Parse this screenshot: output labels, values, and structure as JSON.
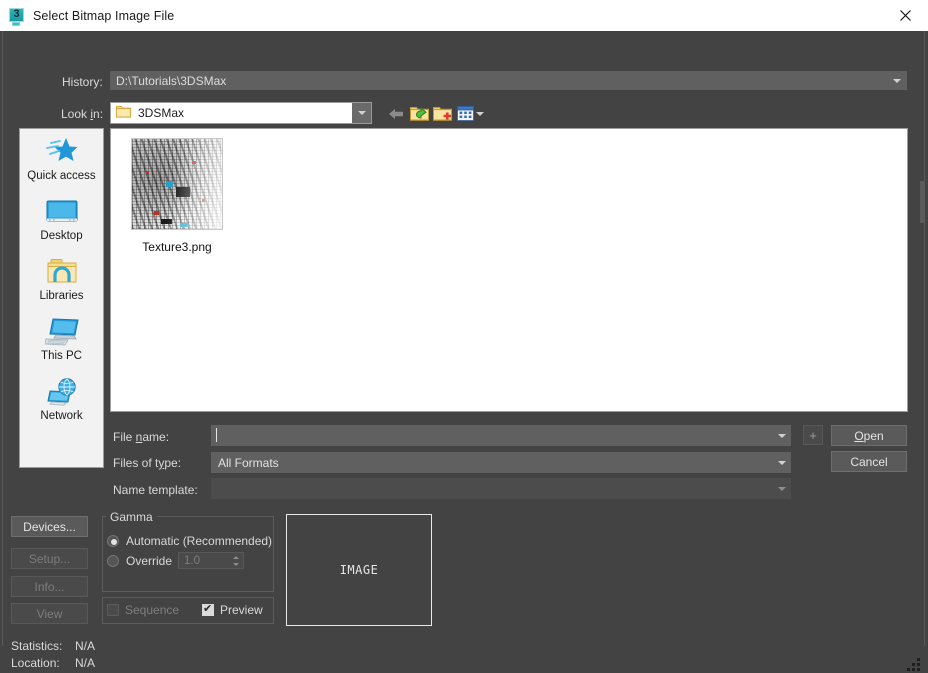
{
  "window": {
    "title": "Select Bitmap Image File",
    "app_icon": "3dsmax-icon",
    "close_label": "✕"
  },
  "history": {
    "label": "History:",
    "value": "D:\\Tutorials\\3DSMax",
    "dropdown_icon": "chevron-down-icon"
  },
  "lookin": {
    "label_pre": "Look ",
    "label_accel": "i",
    "label_post": "n:",
    "value": "3DSMax",
    "folder_icon": "folder-icon",
    "dropdown_icon": "chevron-down-icon"
  },
  "toolbar": {
    "back": "back-arrow-icon",
    "up": "up-one-level-icon",
    "new_folder": "new-folder-icon",
    "view_mode": "view-menu-icon",
    "view_caret": "chevron-down-icon"
  },
  "places": [
    {
      "label": "Quick access",
      "icon": "star-icon"
    },
    {
      "label": "Desktop",
      "icon": "monitor-icon"
    },
    {
      "label": "Libraries",
      "icon": "libraries-folder-icon"
    },
    {
      "label": "This PC",
      "icon": "computer-icon"
    },
    {
      "label": "Network",
      "icon": "network-globe-icon"
    }
  ],
  "files": [
    {
      "name": "Texture3.png",
      "thumbnail": "texture-thumbnail"
    }
  ],
  "form": {
    "filename": {
      "label_pre": "File ",
      "label_accel": "n",
      "label_post": "ame:",
      "value": "",
      "dropdown_icon": "chevron-down-icon"
    },
    "filetype": {
      "label_pre": "Files of t",
      "label_accel": "y",
      "label_post": "pe:",
      "value": "All Formats",
      "dropdown_icon": "chevron-down-icon"
    },
    "nametemplate": {
      "label": "Name template:",
      "value": "",
      "dropdown_icon": "chevron-down-icon"
    },
    "plus_button": "+",
    "open_pre": "",
    "open_accel": "O",
    "open_post": "pen",
    "cancel_label": "Cancel"
  },
  "left_buttons": [
    {
      "label": "Devices...",
      "enabled": true
    },
    {
      "label": "Setup...",
      "enabled": false
    },
    {
      "label": "Info...",
      "enabled": false
    },
    {
      "label": "View",
      "enabled": false
    }
  ],
  "status": {
    "statistics_label": "Statistics:",
    "statistics_value": "N/A",
    "location_label": "Location:",
    "location_value": "N/A"
  },
  "gamma": {
    "legend": "Gamma",
    "automatic_label": "Automatic (Recommended)",
    "automatic_selected": true,
    "override_label": "Override",
    "override_selected": false,
    "override_value": "1.0"
  },
  "options": {
    "sequence_label": "Sequence",
    "sequence_checked": false,
    "sequence_enabled": false,
    "preview_label": "Preview",
    "preview_checked": true
  },
  "preview": {
    "placeholder": "IMAGE"
  },
  "colors": {
    "dialog_bg": "#434343",
    "field_bg": "#606060",
    "field_disabled_bg": "#4c4c4c",
    "button_bg": "#5a5a5a",
    "list_bg": "#ffffff",
    "places_bg": "#f2f2f2",
    "text": "#d9d9d9",
    "text_disabled": "#7e7e7e",
    "titlebar_bg": "#ffffff",
    "accent_folder": "#f5d271"
  }
}
